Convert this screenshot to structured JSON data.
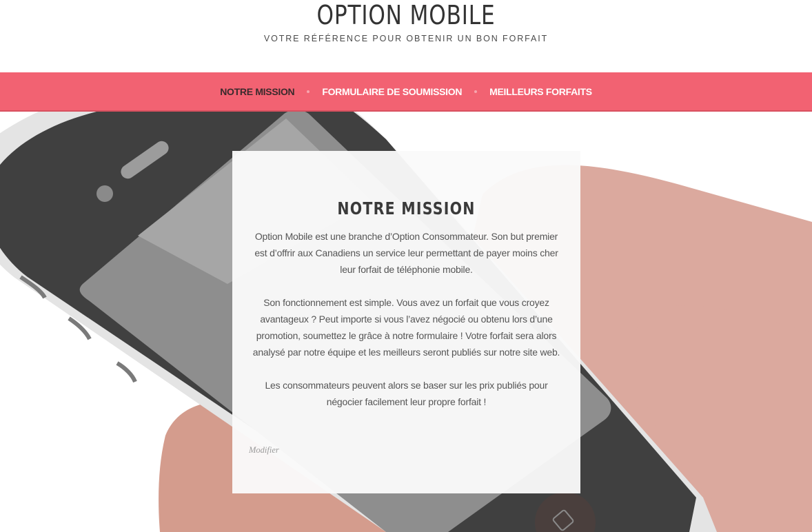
{
  "site": {
    "title": "OPTION MOBILE",
    "tagline": "VOTRE RÉFÉRENCE POUR OBTENIR UN BON FORFAIT"
  },
  "nav": {
    "items": [
      {
        "label": "NOTRE MISSION",
        "active": true
      },
      {
        "label": "FORMULAIRE DE SOUMISSION",
        "active": false
      },
      {
        "label": "MEILLEURS FORFAITS",
        "active": false
      }
    ]
  },
  "mission": {
    "title": "NOTRE MISSION",
    "paragraphs": [
      "Option Mobile est une branche d’Option Consommateur. Son but premier est d’offrir aux Canadiens un service leur permettant de payer moins cher leur forfait de téléphonie mobile.",
      "Son fonctionnement est simple. Vous avez un forfait que vous croyez avantageux ? Peut importe si vous l’avez négocié ou obtenu lors d’une promotion, soumettez le grâce à notre formulaire ! Votre forfait sera alors analysé par notre équipe et les meilleurs seront publiés sur notre site web.",
      "Les consommateurs peuvent alors se baser sur les prix publiés pour négocier facilement leur propre forfait !"
    ],
    "edit_link": "Modifier"
  },
  "colors": {
    "nav_background": "#f26272",
    "nav_active_text": "#3a2a2c",
    "phone_body": "#404040",
    "phone_screen": "#8c8c8c",
    "hand_skin": "#dba99e"
  },
  "hero": {
    "image": "phone-in-hand-illustration"
  }
}
